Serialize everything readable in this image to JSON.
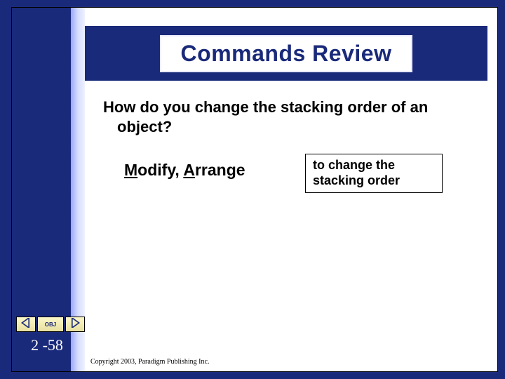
{
  "colors": {
    "primary": "#1a2a7a",
    "nav_bg": "#f5efb0"
  },
  "title": "Commands Review",
  "question_line1": "How do you change the stacking order of an",
  "question_line2": "object?",
  "answer_html": {
    "m": "M",
    "odify": "odify, ",
    "a": "A",
    "rrange": "rrange"
  },
  "explanation_line1": "to change the",
  "explanation_line2": "stacking order",
  "nav": {
    "obj_label": "OBJ"
  },
  "page_number": "2 -58",
  "copyright": "Copyright 2003, Paradigm Publishing Inc."
}
